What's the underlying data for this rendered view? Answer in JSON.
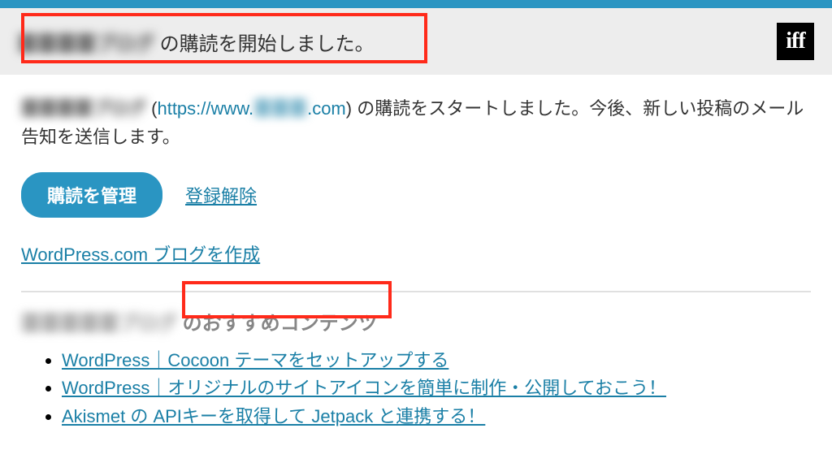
{
  "header": {
    "blog_name_masked": "〓〓〓〓ブログ",
    "title_suffix": " の購読を開始しました。",
    "logo_text": "iff"
  },
  "lead": {
    "blog_name_masked": "〓〓〓〓ブログ",
    "paren_open": " (",
    "url_prefix": "https://www.",
    "url_masked": "〓〓〓",
    "url_suffix": ".com",
    "paren_close": ") ",
    "rest": "の購読をスタートしました。今後、新しい投稿のメール告知を送信します。"
  },
  "actions": {
    "manage_label": "購読を管理",
    "unsubscribe_label": "登録解除"
  },
  "create_blog_label": "WordPress.com ブログを作成",
  "recommend": {
    "blog_name_masked": "〓〓〓〓〓ブログ",
    "heading_suffix": " のおすすめコンテンツ",
    "items": [
      {
        "label": "WordPress｜Cocoon テーマをセットアップする"
      },
      {
        "label": "WordPress｜オリジナルのサイトアイコンを簡単に制作・公開しておこう！"
      },
      {
        "label": "Akismet の APIキーを取得して Jetpack と連携する！"
      }
    ]
  }
}
